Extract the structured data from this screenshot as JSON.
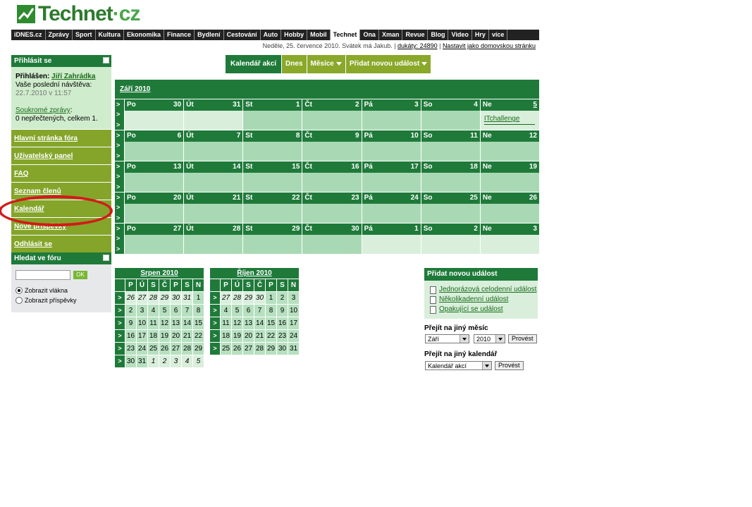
{
  "site": {
    "logo_main": "Technet",
    "logo_suffix": "cz"
  },
  "topnav": [
    "iDNES.cz",
    "Zprávy",
    "Sport",
    "Kultura",
    "Ekonomika",
    "Finance",
    "Bydlení",
    "Cestování",
    "Auto",
    "Hobby",
    "Mobil",
    "Technet",
    "Ona",
    "Xman",
    "Revue",
    "Blog",
    "Video",
    "Hry",
    "více"
  ],
  "topnav_active": "Technet",
  "subline": {
    "text": "Neděle, 25. července 2010. Svátek má Jakub.",
    "dukaty": "dukáty: 24890",
    "homepage": "Nastavit jako domovskou stránku"
  },
  "sidebar": {
    "login_title": "Přihlásit se",
    "logged_label": "Přihlášen:",
    "user": "Jiří Zahrádka",
    "last_visit_label": "Vaše poslední návštěva:",
    "last_visit": "22.7.2010 v 11:57",
    "pm_link": "Soukromé zprávy",
    "pm_status": "0 nepřečtených, celkem 1.",
    "links": [
      "Hlavní stránka fóra",
      "Uživatelský panel",
      "FAQ",
      "Seznam členů",
      "Kalendář",
      "Nové příspěvky",
      "Odhlásit se"
    ],
    "search_title": "Hledat ve fóru",
    "search_button": "OK",
    "radio1": "Zobrazit vlákna",
    "radio2": "Zobrazit příspěvky"
  },
  "toolbar": {
    "calendar": "Kalendář akcí",
    "today": "Dnes",
    "months": "Měsíce",
    "add": "Přidat novou událost"
  },
  "calendar": {
    "month_title": "Září 2010",
    "weeks": [
      [
        [
          "Po",
          "30",
          0
        ],
        [
          "Út",
          "31",
          0
        ],
        [
          "St",
          "1",
          1
        ],
        [
          "Čt",
          "2",
          1
        ],
        [
          "Pá",
          "3",
          1
        ],
        [
          "So",
          "4",
          1
        ],
        [
          "Ne",
          "5",
          1
        ]
      ],
      [
        [
          "Po",
          "6",
          1
        ],
        [
          "Út",
          "7",
          1
        ],
        [
          "St",
          "8",
          1
        ],
        [
          "Čt",
          "9",
          1
        ],
        [
          "Pá",
          "10",
          1
        ],
        [
          "So",
          "11",
          1
        ],
        [
          "Ne",
          "12",
          1
        ]
      ],
      [
        [
          "Po",
          "13",
          1
        ],
        [
          "Út",
          "14",
          1
        ],
        [
          "St",
          "15",
          1
        ],
        [
          "Čt",
          "16",
          1
        ],
        [
          "Pá",
          "17",
          1
        ],
        [
          "So",
          "18",
          1
        ],
        [
          "Ne",
          "19",
          1
        ]
      ],
      [
        [
          "Po",
          "20",
          1
        ],
        [
          "Út",
          "21",
          1
        ],
        [
          "St",
          "22",
          1
        ],
        [
          "Čt",
          "23",
          1
        ],
        [
          "Pá",
          "24",
          1
        ],
        [
          "So",
          "25",
          1
        ],
        [
          "Ne",
          "26",
          1
        ]
      ],
      [
        [
          "Po",
          "27",
          1
        ],
        [
          "Út",
          "28",
          1
        ],
        [
          "St",
          "29",
          1
        ],
        [
          "Čt",
          "30",
          1
        ],
        [
          "Pá",
          "1",
          0
        ],
        [
          "So",
          "2",
          0
        ],
        [
          "Ne",
          "3",
          0
        ]
      ]
    ],
    "event": {
      "week": 0,
      "day": 6,
      "label": "ITchallenge"
    }
  },
  "mini_calendars": [
    {
      "title": "Srpen 2010",
      "headers": [
        "P",
        "Ú",
        "S",
        "Č",
        "P",
        "S",
        "N"
      ],
      "rows": [
        [
          "26",
          "27",
          "28",
          "29",
          "30",
          "31",
          "1"
        ],
        [
          "2",
          "3",
          "4",
          "5",
          "6",
          "7",
          "8"
        ],
        [
          "9",
          "10",
          "11",
          "12",
          "13",
          "14",
          "15"
        ],
        [
          "16",
          "17",
          "18",
          "19",
          "20",
          "21",
          "22"
        ],
        [
          "23",
          "24",
          "25",
          "26",
          "27",
          "28",
          "29"
        ],
        [
          "30",
          "31",
          "1",
          "2",
          "3",
          "4",
          "5"
        ]
      ],
      "other": [
        [
          1,
          1,
          1,
          1,
          1,
          1,
          0
        ],
        [
          0,
          0,
          0,
          0,
          0,
          0,
          0
        ],
        [
          0,
          0,
          0,
          0,
          0,
          0,
          0
        ],
        [
          0,
          0,
          0,
          0,
          0,
          0,
          0
        ],
        [
          0,
          0,
          0,
          0,
          0,
          0,
          0
        ],
        [
          0,
          0,
          1,
          1,
          1,
          1,
          1
        ]
      ]
    },
    {
      "title": "Říjen 2010",
      "headers": [
        "P",
        "Ú",
        "S",
        "Č",
        "P",
        "S",
        "N"
      ],
      "rows": [
        [
          "27",
          "28",
          "29",
          "30",
          "1",
          "2",
          "3"
        ],
        [
          "4",
          "5",
          "6",
          "7",
          "8",
          "9",
          "10"
        ],
        [
          "11",
          "12",
          "13",
          "14",
          "15",
          "16",
          "17"
        ],
        [
          "18",
          "19",
          "20",
          "21",
          "22",
          "23",
          "24"
        ],
        [
          "25",
          "26",
          "27",
          "28",
          "29",
          "30",
          "31"
        ]
      ],
      "other": [
        [
          1,
          1,
          1,
          1,
          0,
          0,
          0
        ],
        [
          0,
          0,
          0,
          0,
          0,
          0,
          0
        ],
        [
          0,
          0,
          0,
          0,
          0,
          0,
          0
        ],
        [
          0,
          0,
          0,
          0,
          0,
          0,
          0
        ],
        [
          0,
          0,
          0,
          0,
          0,
          0,
          0
        ]
      ]
    }
  ],
  "add_panel": {
    "title": "Přidat novou událost",
    "items": [
      "Jednorázová celodenní událost",
      "Několikadenní událost",
      "Opakující se událost"
    ],
    "goto_month_label": "Přejít na jiný měsíc",
    "month_value": "Září",
    "year_value": "2010",
    "go_button": "Provést",
    "goto_cal_label": "Přejít na jiný kalendář",
    "cal_value": "Kalendář akcí"
  },
  "colors": {
    "dark_green": "#1f7a3a",
    "olive": "#84a52a",
    "cell": "#a9d9b4",
    "light_cell": "#d9efdc",
    "annotation": "#d21a1a"
  }
}
